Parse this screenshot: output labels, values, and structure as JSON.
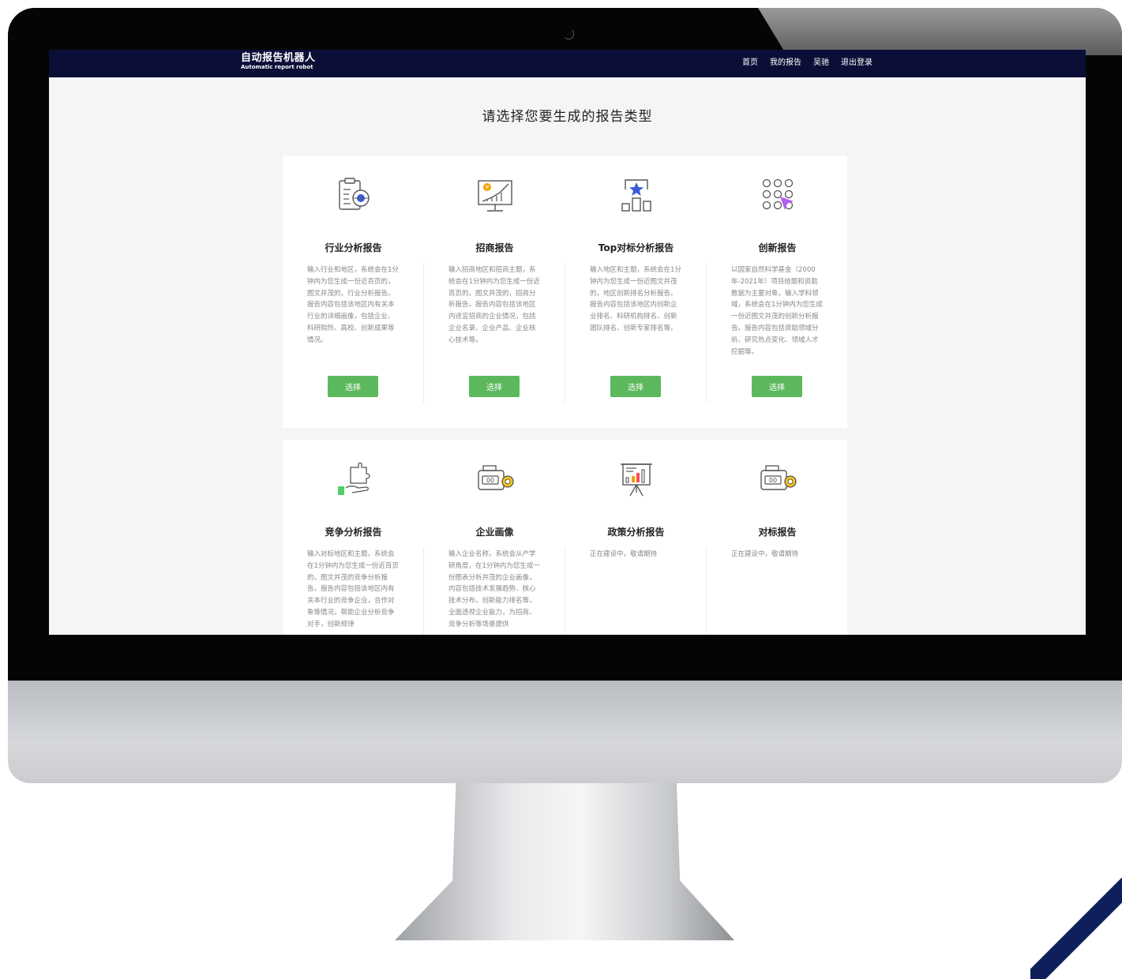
{
  "header": {
    "brand_cn": "自动报告机器人",
    "brand_en": "Automatic report robot",
    "nav": [
      "首页",
      "我的报告",
      "吴驰",
      "退出登录"
    ]
  },
  "page_title": "请选择您要生成的报告类型",
  "colors": {
    "topbar": "#0b0e36",
    "button": "#5cb85c",
    "accent_blue": "#3b5bdb",
    "accent_orange": "#f59f00",
    "accent_purple": "#b45cf0"
  },
  "cards_row1": [
    {
      "icon": "industry-analysis-icon",
      "title": "行业分析报告",
      "desc": "输入行业和地区，系统会在1分钟内为您生成一份近百页的，图文并茂的，行业分析报告。报告内容包括该地区内有关本行业的详细画像，包括企业、科研院所、高校、创新成果等情况。",
      "button": "选择"
    },
    {
      "icon": "investment-report-icon",
      "title": "招商报告",
      "desc": "输入招商地区和招商主题，系统会在1分钟内为您生成一份近百页的，图文并茂的，招商分析报告。报告内容包括该地区内适宜招商的企业情况，包括企业名录、企业产品、企业核心技术等。",
      "button": "选择"
    },
    {
      "icon": "top-benchmark-icon",
      "title": "Top对标分析报告",
      "desc": "输入地区和主题，系统会在1分钟内为您生成一份近图文并茂的，地区创新排名分析报告。报告内容包括该地区内创新企业排名、科研机构排名、创新团队排名、创新专家排名等。",
      "button": "选择"
    },
    {
      "icon": "innovation-report-icon",
      "title": "创新报告",
      "desc": "以国家自然科学基金（2000年-2021年）项目结题和资助数据为主要对象，输入学科领域，系统会在1分钟内为您生成一份近图文并茂的创新分析报告。报告内容包括资助领域分析、研究热点变化、领域人才挖掘等。",
      "button": "选择"
    }
  ],
  "cards_row2": [
    {
      "icon": "competition-analysis-icon",
      "title": "竞争分析报告",
      "desc": "输入对标地区和主题，系统会在1分钟内为您生成一份近百页的，图文并茂的竞争分析报告。报告内容包括该地区内有关本行业的竞争企业，合作对象等情况，帮助企业分析竞争对手，创新规律"
    },
    {
      "icon": "enterprise-profile-icon",
      "title": "企业画像",
      "desc": "输入企业名称，系统会从产学研角度，在1分钟内为您生成一份图表分析并茂的企业画像，内容包括技术发展趋势、核心技术分布，创新能力排名等，全面透视企业能力，为招商、竞争分析等场景提供"
    },
    {
      "icon": "policy-analysis-icon",
      "title": "政策分析报告",
      "desc": "正在建设中，敬请期待"
    },
    {
      "icon": "benchmark-report-icon",
      "title": "对标报告",
      "desc": "正在建设中，敬请期待"
    }
  ]
}
